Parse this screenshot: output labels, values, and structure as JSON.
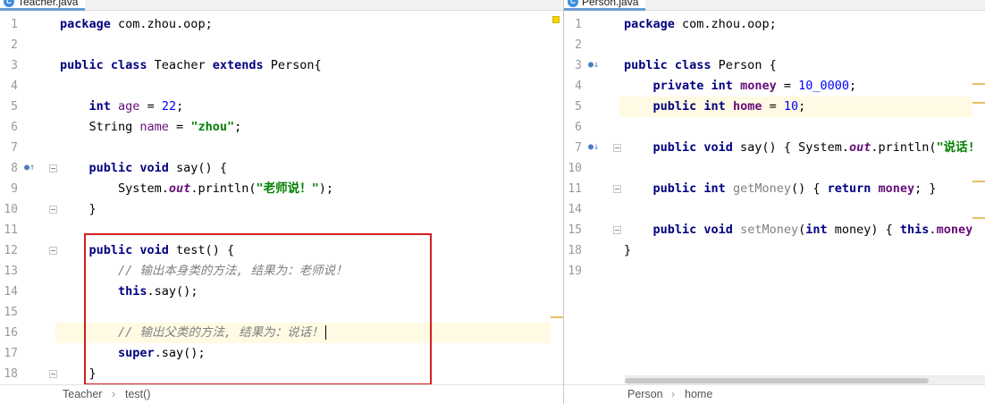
{
  "left_editor": {
    "tab": {
      "icon": "C",
      "label": "Teacher.java"
    },
    "lines": [
      {
        "num": "1",
        "parts": [
          [
            "kw",
            "package"
          ],
          [
            "t",
            " com.zhou.oop;"
          ]
        ]
      },
      {
        "num": "2",
        "parts": []
      },
      {
        "num": "3",
        "parts": [
          [
            "kw",
            "public class"
          ],
          [
            "t",
            " Teacher "
          ],
          [
            "kw",
            "extends"
          ],
          [
            "t",
            " Person{"
          ]
        ]
      },
      {
        "num": "4",
        "parts": []
      },
      {
        "num": "5",
        "parts": [
          [
            "t",
            "    "
          ],
          [
            "kw",
            "int"
          ],
          [
            "t",
            " "
          ],
          [
            "fld",
            "age"
          ],
          [
            "t",
            " = "
          ],
          [
            "num",
            "22"
          ],
          [
            "t",
            ";"
          ]
        ]
      },
      {
        "num": "6",
        "parts": [
          [
            "t",
            "    String "
          ],
          [
            "fld",
            "name"
          ],
          [
            "t",
            " = "
          ],
          [
            "str",
            "\"zhou\""
          ],
          [
            "t",
            ";"
          ]
        ]
      },
      {
        "num": "7",
        "parts": []
      },
      {
        "num": "8",
        "parts": [
          [
            "t",
            "    "
          ],
          [
            "kw",
            "public void"
          ],
          [
            "t",
            " say() {"
          ]
        ]
      },
      {
        "num": "9",
        "parts": [
          [
            "t",
            "        System."
          ],
          [
            "ita",
            "out"
          ],
          [
            "t",
            ".println("
          ],
          [
            "str",
            "\"老师说！\""
          ],
          [
            "t",
            ");"
          ]
        ]
      },
      {
        "num": "10",
        "parts": [
          [
            "t",
            "    }"
          ]
        ]
      },
      {
        "num": "11",
        "parts": []
      },
      {
        "num": "12",
        "parts": [
          [
            "t",
            "    "
          ],
          [
            "kw",
            "public void"
          ],
          [
            "t",
            " test() {"
          ]
        ]
      },
      {
        "num": "13",
        "parts": [
          [
            "t",
            "        "
          ],
          [
            "cmt",
            "// 输出本身类的方法, 结果为：老师说！"
          ]
        ]
      },
      {
        "num": "14",
        "parts": [
          [
            "t",
            "        "
          ],
          [
            "kw",
            "this"
          ],
          [
            "t",
            ".say();"
          ]
        ]
      },
      {
        "num": "15",
        "parts": []
      },
      {
        "num": "16",
        "parts": [
          [
            "t",
            "        "
          ],
          [
            "cmt",
            "// 输出父类的方法, 结果为：说话！"
          ]
        ]
      },
      {
        "num": "17",
        "parts": [
          [
            "t",
            "        "
          ],
          [
            "kw",
            "super"
          ],
          [
            "t",
            ".say();"
          ]
        ]
      },
      {
        "num": "18",
        "parts": [
          [
            "t",
            "    }"
          ]
        ]
      }
    ],
    "breadcrumb": [
      "Teacher",
      "test()"
    ]
  },
  "right_editor": {
    "tab": {
      "icon": "C",
      "label": "Person.java"
    },
    "lines": [
      {
        "num": "1",
        "parts": [
          [
            "kw",
            "package"
          ],
          [
            "t",
            " com.zhou.oop;"
          ]
        ]
      },
      {
        "num": "2",
        "parts": []
      },
      {
        "num": "3",
        "parts": [
          [
            "kw",
            "public class"
          ],
          [
            "t",
            " Person {"
          ]
        ]
      },
      {
        "num": "4",
        "parts": [
          [
            "t",
            "    "
          ],
          [
            "kw",
            "private int"
          ],
          [
            "t",
            " "
          ],
          [
            "fldb",
            "money"
          ],
          [
            "t",
            " = "
          ],
          [
            "num",
            "10_0000"
          ],
          [
            "t",
            ";"
          ]
        ]
      },
      {
        "num": "5",
        "parts": [
          [
            "t",
            "    "
          ],
          [
            "kw",
            "public int"
          ],
          [
            "t",
            " "
          ],
          [
            "fldb",
            "home"
          ],
          [
            "t",
            " = "
          ],
          [
            "num",
            "10"
          ],
          [
            "t",
            ";"
          ]
        ]
      },
      {
        "num": "6",
        "parts": []
      },
      {
        "num": "7",
        "parts": [
          [
            "t",
            "    "
          ],
          [
            "kw",
            "public void"
          ],
          [
            "t",
            " say() { System."
          ],
          [
            "ita",
            "out"
          ],
          [
            "t",
            ".println("
          ],
          [
            "str",
            "\"说话!\""
          ]
        ]
      },
      {
        "num": "10",
        "parts": []
      },
      {
        "num": "11",
        "parts": [
          [
            "t",
            "    "
          ],
          [
            "kw",
            "public int"
          ],
          [
            "t",
            " "
          ],
          [
            "grey",
            "getMoney"
          ],
          [
            "t",
            "() { "
          ],
          [
            "kw",
            "return"
          ],
          [
            "t",
            " "
          ],
          [
            "fldb",
            "money"
          ],
          [
            "t",
            "; }"
          ]
        ]
      },
      {
        "num": "14",
        "parts": []
      },
      {
        "num": "15",
        "parts": [
          [
            "t",
            "    "
          ],
          [
            "kw",
            "public void"
          ],
          [
            "t",
            " "
          ],
          [
            "grey",
            "setMoney"
          ],
          [
            "t",
            "("
          ],
          [
            "kw",
            "int"
          ],
          [
            "t",
            " money) { "
          ],
          [
            "kw",
            "this"
          ],
          [
            "t",
            "."
          ],
          [
            "fldb",
            "money"
          ],
          [
            "t",
            " ="
          ]
        ]
      },
      {
        "num": "18",
        "parts": [
          [
            "t",
            "}"
          ]
        ]
      },
      {
        "num": "19",
        "parts": []
      }
    ],
    "breadcrumb": [
      "Person",
      "home"
    ]
  },
  "colors": {
    "keyword": "#000080",
    "field": "#660e7a",
    "string": "#008000",
    "number": "#0000ff",
    "comment": "#808080",
    "selection_box": "#d11f1f",
    "current_line": "#fffae3"
  }
}
